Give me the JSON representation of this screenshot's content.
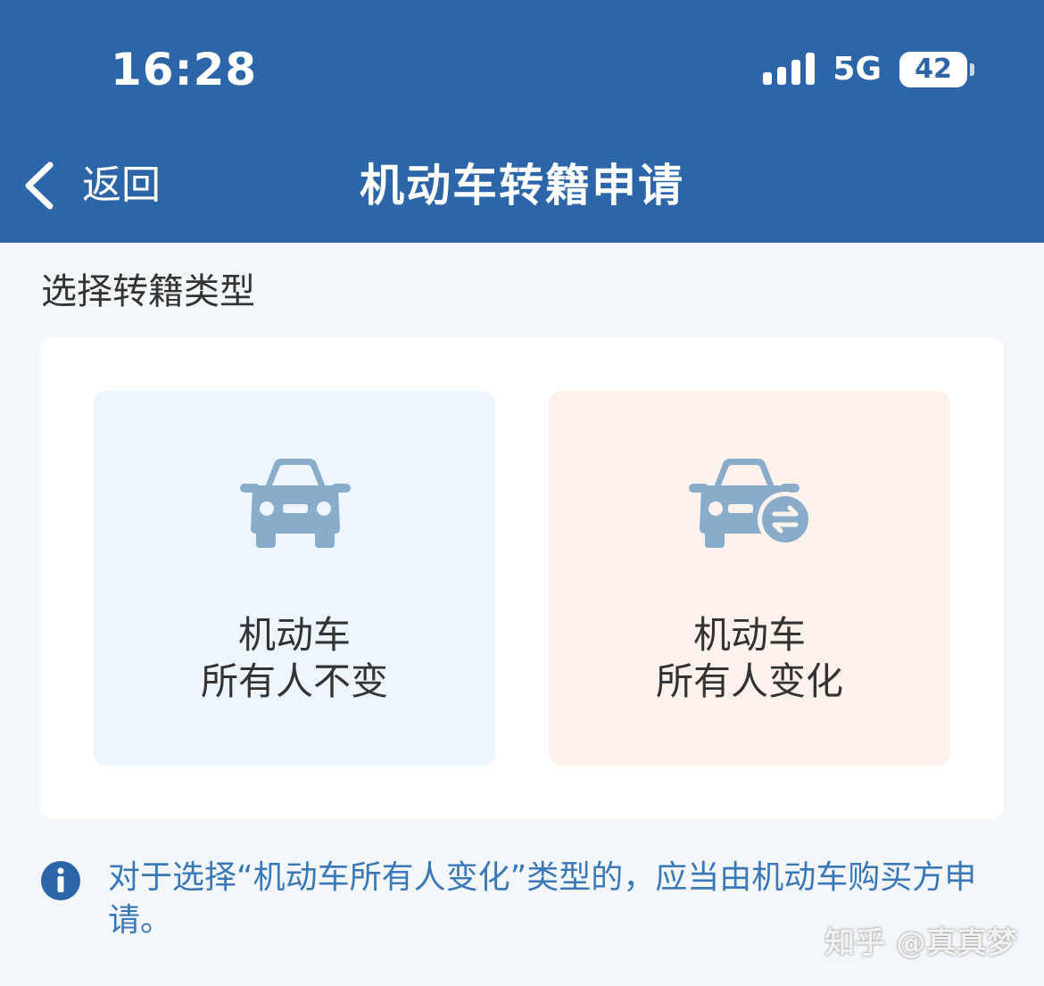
{
  "status_bar": {
    "time": "16:28",
    "network": "5G",
    "battery": "42",
    "signal_icon": "signal-bars-icon"
  },
  "nav": {
    "back_label": "返回",
    "back_icon": "chevron-left-icon",
    "title": "机动车转籍申请"
  },
  "section": {
    "title": "选择转籍类型"
  },
  "options": [
    {
      "line1": "机动车",
      "line2": "所有人不变",
      "icon": "car-icon",
      "background": "#eef6fd"
    },
    {
      "line1": "机动车",
      "line2": "所有人变化",
      "icon": "car-transfer-icon",
      "background": "#fdf3ec"
    }
  ],
  "notice": {
    "icon": "info-icon",
    "text": "对于选择“机动车所有人变化”类型的，应当由机动车购买方申请。"
  },
  "watermark": "知乎 @真真梦",
  "colors": {
    "header": "#2d65a9",
    "icon": "#8aaccb",
    "notice_text": "#3a78b8",
    "info_icon": "#2d65a9"
  }
}
